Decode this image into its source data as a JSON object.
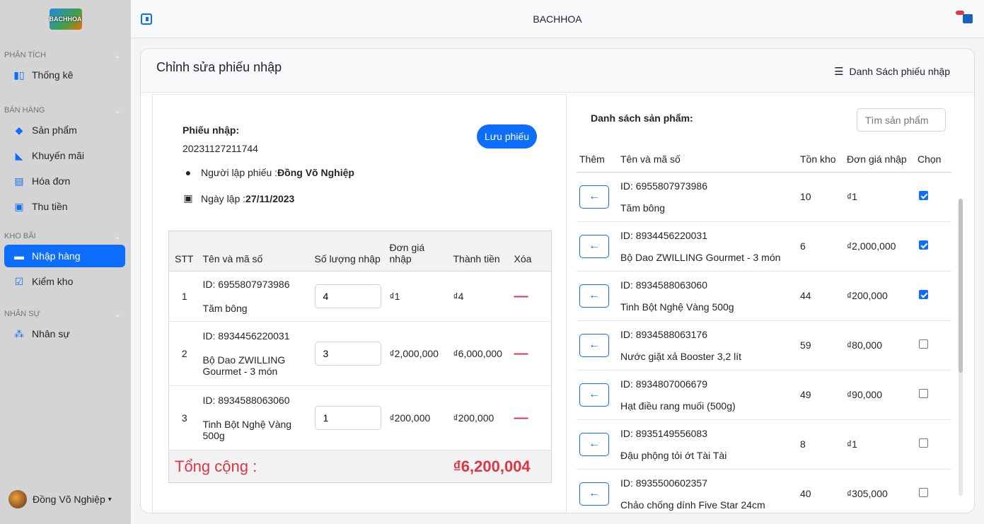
{
  "sidebar": {
    "logo_text": "BACHHOA",
    "sections": [
      {
        "title": "PHÂN TÍCH",
        "items": [
          {
            "label": "Thống kê",
            "icon": "bar-chart-icon"
          }
        ]
      },
      {
        "title": "BÁN HÀNG",
        "items": [
          {
            "label": "Sản phẩm",
            "icon": "box-icon"
          },
          {
            "label": "Khuyến mãi",
            "icon": "tag-icon"
          },
          {
            "label": "Hóa đơn",
            "icon": "receipt-icon"
          },
          {
            "label": "Thu tiền",
            "icon": "cash-icon"
          }
        ]
      },
      {
        "title": "KHO BÃI",
        "items": [
          {
            "label": "Nhập hàng",
            "icon": "cart-icon",
            "active": true
          },
          {
            "label": "Kiểm kho",
            "icon": "check-square-icon"
          }
        ]
      },
      {
        "title": "NHÂN SỰ",
        "items": [
          {
            "label": "Nhân sự",
            "icon": "users-icon"
          }
        ]
      }
    ],
    "user_name": "Đồng Võ Nghiệp"
  },
  "topbar": {
    "brand": "BACHHOA"
  },
  "page": {
    "title": "Chỉnh sửa phiếu nhập",
    "list_link": "Danh Sách phiếu nhập"
  },
  "receipt": {
    "label": "Phiếu nhập:",
    "code": "20231127211744",
    "save_button": "Lưu phiếu",
    "creator_label": "Người lập phiếu :",
    "creator": "Đồng Võ Nghiệp",
    "date_label": "Ngày lập :",
    "date": "27/11/2023"
  },
  "items_table": {
    "headers": {
      "stt": "STT",
      "name": "Tên và mã số",
      "qty": "Số lượng nhập",
      "price": "Đơn giá nhập",
      "total": "Thành tiền",
      "delete": "Xóa"
    },
    "rows": [
      {
        "stt": "1",
        "id": "ID: 6955807973986",
        "name": "Tăm bông",
        "qty": "4",
        "price": "₫1",
        "total": "₫4"
      },
      {
        "stt": "2",
        "id": "ID: 8934456220031",
        "name": "Bộ Dao ZWILLING Gourmet - 3 món",
        "qty": "3",
        "price": "₫2,000,000",
        "total": "₫6,000,000"
      },
      {
        "stt": "3",
        "id": "ID: 8934588063060",
        "name": "Tinh Bột Nghệ Vàng 500g",
        "qty": "1",
        "price": "₫200,000",
        "total": "₫200,000"
      }
    ],
    "total_label": "Tổng cộng :",
    "total_value": "₫6,200,004"
  },
  "products": {
    "title": "Danh sách sản phẩm:",
    "search_placeholder": "Tìm sản phẩm",
    "headers": {
      "add": "Thêm",
      "name": "Tên và mã số",
      "stock": "Tồn kho",
      "price": "Đơn giá nhập",
      "select": "Chọn"
    },
    "rows": [
      {
        "id": "ID: 6955807973986",
        "name": "Tăm bông",
        "stock": "10",
        "price": "₫1",
        "checked": true
      },
      {
        "id": "ID: 8934456220031",
        "name": "Bộ Dao ZWILLING Gourmet - 3 món",
        "stock": "6",
        "price": "₫2,000,000",
        "checked": true
      },
      {
        "id": "ID: 8934588063060",
        "name": "Tinh Bột Nghệ Vàng 500g",
        "stock": "44",
        "price": "₫200,000",
        "checked": true
      },
      {
        "id": "ID: 8934588063176",
        "name": "Nước giặt xả Booster 3,2 lít",
        "stock": "59",
        "price": "₫80,000",
        "checked": false
      },
      {
        "id": "ID: 8934807006679",
        "name": "Hạt điều rang muối (500g)",
        "stock": "49",
        "price": "₫90,000",
        "checked": false
      },
      {
        "id": "ID: 8935149556083",
        "name": "Đậu phộng tỏi ớt Tài Tài",
        "stock": "8",
        "price": "₫1",
        "checked": false
      },
      {
        "id": "ID: 8935500602357",
        "name": "Chảo chống dính Five Star 24cm",
        "stock": "40",
        "price": "₫305,000",
        "checked": false
      }
    ]
  },
  "colors": {
    "accent": "#0d6efd",
    "danger": "#dc3545",
    "sidebar_bg": "#d4d4d4"
  }
}
